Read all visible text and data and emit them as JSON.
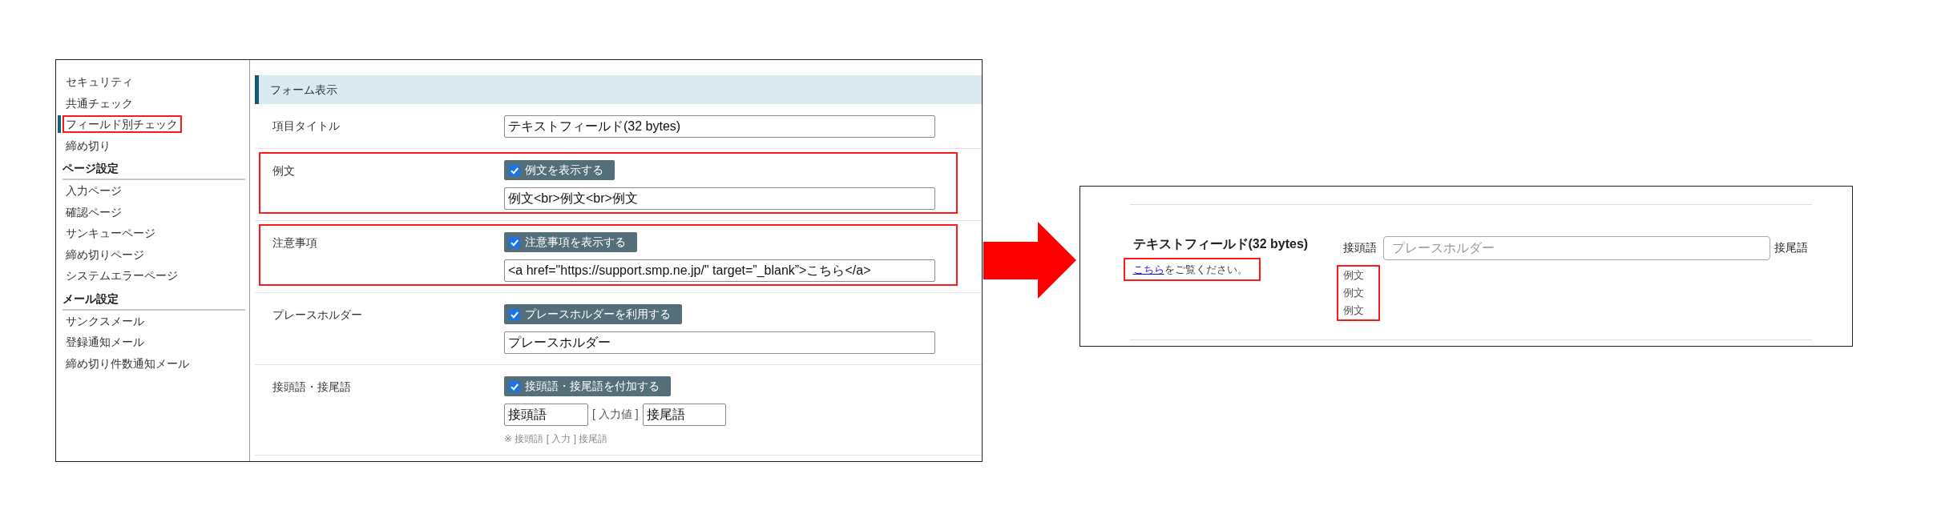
{
  "sidebar": {
    "sections": [
      {
        "items": [
          {
            "label": "セキュリティ",
            "selected": false,
            "highlighted": false
          },
          {
            "label": "共通チェック",
            "selected": false,
            "highlighted": false
          },
          {
            "label": "フィールド別チェック",
            "selected": true,
            "highlighted": true
          },
          {
            "label": "締め切り",
            "selected": false,
            "highlighted": false
          }
        ]
      },
      {
        "heading": "ページ設定",
        "items": [
          {
            "label": "入力ページ",
            "selected": false,
            "highlighted": false
          },
          {
            "label": "確認ページ",
            "selected": false,
            "highlighted": false
          },
          {
            "label": "サンキューページ",
            "selected": false,
            "highlighted": false
          },
          {
            "label": "締め切りページ",
            "selected": false,
            "highlighted": false
          },
          {
            "label": "システムエラーページ",
            "selected": false,
            "highlighted": false
          }
        ]
      },
      {
        "heading": "メール設定",
        "items": [
          {
            "label": "サンクスメール",
            "selected": false,
            "highlighted": false
          },
          {
            "label": "登録通知メール",
            "selected": false,
            "highlighted": false
          },
          {
            "label": "締め切り件数通知メール",
            "selected": false,
            "highlighted": false
          }
        ]
      }
    ]
  },
  "form": {
    "section_title": "フォーム表示",
    "rows": [
      {
        "kind": "text",
        "label": "項目タイトル",
        "highlighted": false,
        "value": "テキストフィールド(32 bytes)"
      },
      {
        "kind": "toggle_text",
        "label": "例文",
        "highlighted": true,
        "toggle": {
          "label": "例文を表示する",
          "checked": true
        },
        "value": "例文<br>例文<br>例文"
      },
      {
        "kind": "toggle_text",
        "label": "注意事項",
        "highlighted": true,
        "toggle": {
          "label": "注意事項を表示する",
          "checked": true
        },
        "value": "<a href=\"https://support.smp.ne.jp/\" target=”_blank”>こちら</a>"
      },
      {
        "kind": "toggle_text",
        "label": "プレースホルダー",
        "highlighted": false,
        "toggle": {
          "label": "プレースホルダーを利用する",
          "checked": true
        },
        "value": "プレースホルダー"
      },
      {
        "kind": "affix",
        "label": "接頭語・接尾語",
        "highlighted": false,
        "toggle": {
          "label": "接頭語・接尾語を付加する",
          "checked": true
        },
        "prefix": "接頭語",
        "separator": "[ 入力値 ]",
        "suffix": "接尾語",
        "note": "※ 接頭語 [ 入力 ] 接尾語"
      }
    ]
  },
  "preview": {
    "title": "テキストフィールド(32 bytes)",
    "note": {
      "link": "こちら",
      "text": "をご覧ください。",
      "highlighted": true
    },
    "prefix": "接頭語",
    "placeholder": "プレースホルダー",
    "suffix": "接尾語",
    "examples": {
      "lines": [
        "例文",
        "例文",
        "例文"
      ],
      "highlighted": true
    }
  }
}
